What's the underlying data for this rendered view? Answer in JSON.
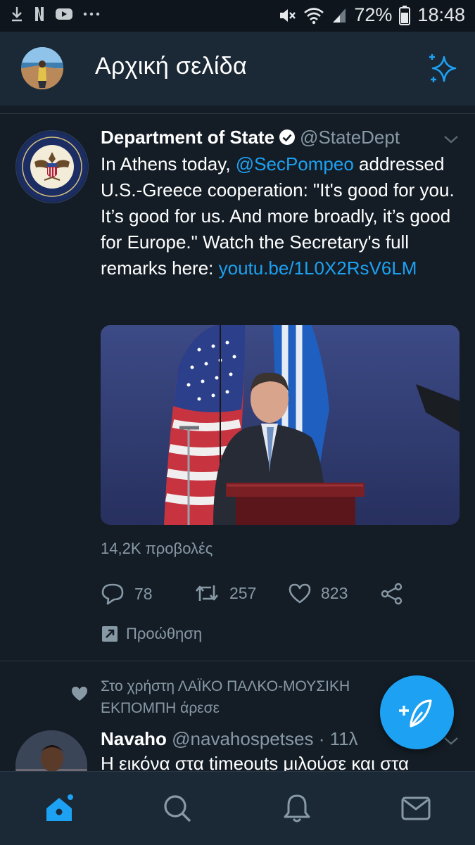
{
  "status_bar": {
    "battery_percent": "72%",
    "time": "18:48",
    "icons_left": [
      "download-icon",
      "netflix-icon",
      "youtube-icon",
      "more-icon"
    ],
    "icons_right": [
      "mute-icon",
      "wifi-icon",
      "signal-icon",
      "battery-icon"
    ]
  },
  "header": {
    "title": "Αρχική σελίδα",
    "avatar_icon": "profile-avatar",
    "sparkle_icon": "sparkle-icon"
  },
  "tweet": {
    "author_name": "Department of State",
    "handle": "@StateDept",
    "text_prefix": "In Athens today, ",
    "mention": "@SecPompeo",
    "text_body": " addressed U.S.-Greece cooperation: \"It's good for you. It’s good for us. And more broadly, it’s good for Europe.\" Watch the Secretary's full remarks here: ",
    "link": "youtu.be/​1L0X2RsV6LM",
    "views": "14,2K προβολές",
    "replies": "78",
    "retweets": "257",
    "likes": "823",
    "promote_label": "Προώθηση"
  },
  "liked_context": {
    "text": "Στο χρήστη ΛΑΪΚΟ ΠΑΛΚΟ-ΜΟΥΣΙΚΗ ΕΚΠΟΜΠΗ άρεσε"
  },
  "tweet2": {
    "author_name": "Navaho",
    "handle": "@navahospetses",
    "time": "· 11λ",
    "text": "Η εικόνα στα timeouts μιλούσε και στα"
  },
  "colors": {
    "background": "#141d26",
    "bar": "#1b2836",
    "accent": "#1da1f2",
    "muted": "#8899a6"
  }
}
